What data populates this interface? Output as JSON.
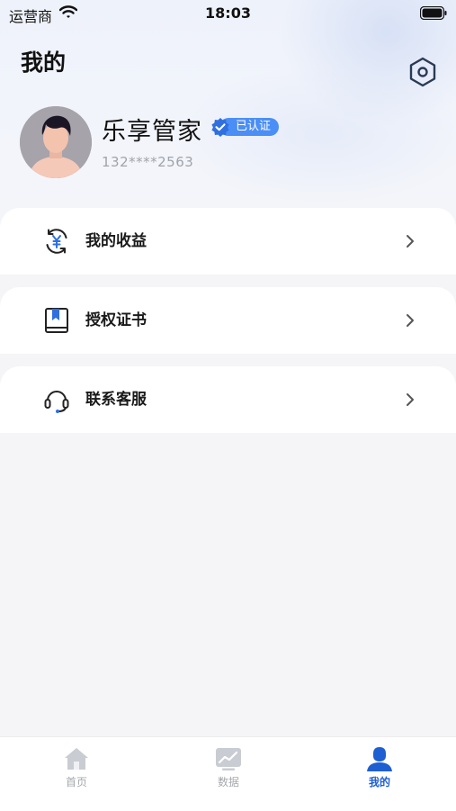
{
  "status_bar": {
    "carrier": "运营商",
    "time": "18:03"
  },
  "header": {
    "title": "我的"
  },
  "profile": {
    "name": "乐享管家",
    "badge": "已认证",
    "phone": "132****2563"
  },
  "menu": [
    {
      "label": "我的收益",
      "icon": "income-yuan-icon"
    },
    {
      "label": "授权证书",
      "icon": "certificate-book-icon"
    },
    {
      "label": "联系客服",
      "icon": "headset-icon"
    }
  ],
  "tabbar": [
    {
      "label": "首页",
      "icon": "home-icon",
      "active": false
    },
    {
      "label": "数据",
      "icon": "chart-icon",
      "active": false
    },
    {
      "label": "我的",
      "icon": "user-icon",
      "active": true
    }
  ],
  "colors": {
    "accent": "#1e5fd1",
    "badge": "#4b8ef5",
    "inactive": "#a5a8ae"
  }
}
